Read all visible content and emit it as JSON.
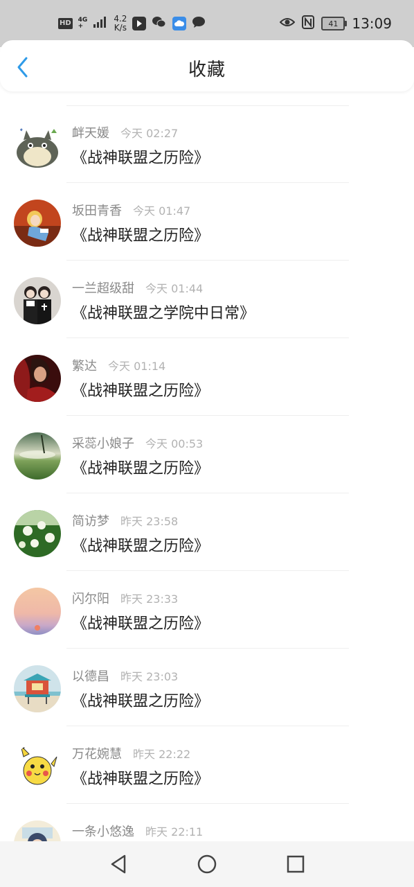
{
  "status_bar": {
    "hd": "HD",
    "network_top": "4G",
    "network_bottom": "+",
    "speed_value": "4.2",
    "speed_unit": "K/s",
    "battery": "41",
    "time": "13:09",
    "icons": [
      "signal-icon",
      "app-icon",
      "wechat-icon",
      "cloud-icon",
      "chat-icon",
      "eye-icon",
      "nfc-icon",
      "battery-icon"
    ],
    "colors": {
      "background": "#cfcfcf",
      "cloud": "#3a8de8"
    }
  },
  "header": {
    "title": "收藏",
    "back_icon": "chevron-left-icon",
    "accent": "#2f9be8"
  },
  "favorites": [
    {
      "user": "衅天媛",
      "time": "今天 02:27",
      "title": "《战神联盟之历险》",
      "avatar": "totoro-avatar"
    },
    {
      "user": "坂田青香",
      "time": "今天 01:47",
      "title": "《战神联盟之历险》",
      "avatar": "alice-avatar"
    },
    {
      "user": "一兰超级甜",
      "time": "今天 01:44",
      "title": "《战神联盟之学院中日常》",
      "avatar": "couple-avatar"
    },
    {
      "user": "繁达",
      "time": "今天 01:14",
      "title": "《战神联盟之历险》",
      "avatar": "red-character-avatar"
    },
    {
      "user": "采蕊小娘子",
      "time": "今天 00:53",
      "title": "《战神联盟之历险》",
      "avatar": "landscape-avatar"
    },
    {
      "user": "简访梦",
      "time": "昨天 23:58",
      "title": "《战神联盟之历险》",
      "avatar": "flowers-avatar"
    },
    {
      "user": "闪尔阳",
      "time": "昨天 23:33",
      "title": "《战神联盟之历险》",
      "avatar": "sunset-avatar"
    },
    {
      "user": "以德昌",
      "time": "昨天 23:03",
      "title": "《战神联盟之历险》",
      "avatar": "beach-hut-avatar"
    },
    {
      "user": "万花婉慧",
      "time": "昨天 22:22",
      "title": "《战神联盟之历险》",
      "avatar": "pikachu-avatar"
    },
    {
      "user": "一条小悠逸",
      "time": "昨天 22:11",
      "title": "",
      "avatar": "anime-avatar"
    }
  ],
  "nav_bar": {
    "buttons": [
      "back-triangle-icon",
      "home-circle-icon",
      "recents-square-icon"
    ]
  }
}
